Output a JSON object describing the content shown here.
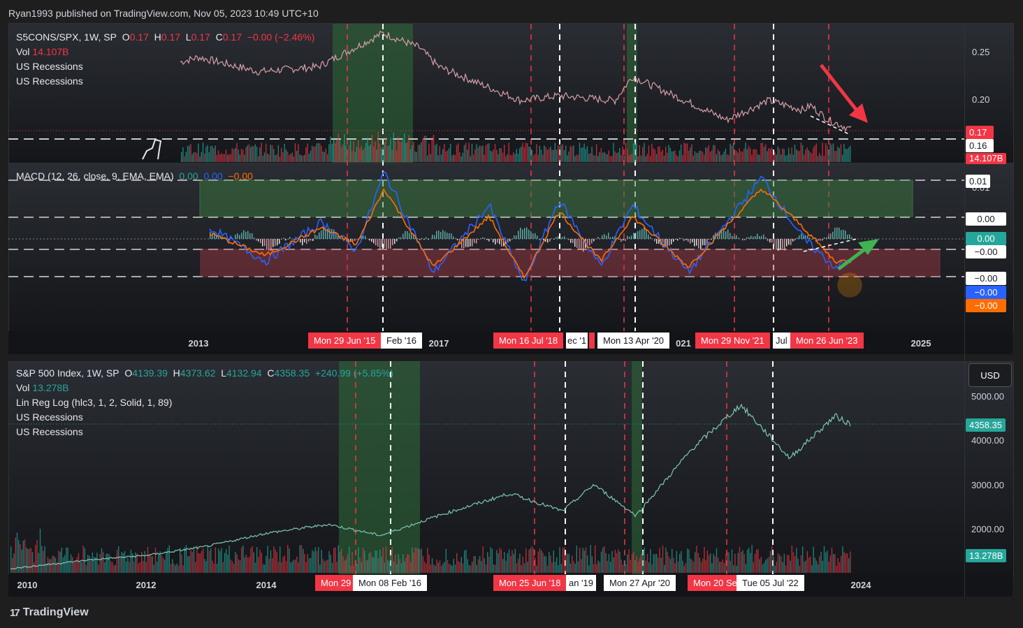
{
  "header": {
    "text": "Ryan1993 published on TradingView.com, Nov 05, 2023 10:49 UTC+10"
  },
  "pane1": {
    "legend": {
      "symbol": "S5CONS/SPX, 1W, SP",
      "o_label": "O",
      "o_value": "0.17",
      "h_label": "H",
      "h_value": "0.17",
      "l_label": "L",
      "l_value": "0.17",
      "c_label": "C",
      "c_value": "0.17",
      "change": "−0.00 (−2.46%)",
      "vol_label": "Vol",
      "vol_value": "14.107B",
      "rec1": "US Recessions",
      "rec2": "US Recessions"
    },
    "price_ticks": [
      "0.25",
      "0.20"
    ],
    "badges": {
      "last": "0.17",
      "line": "0.16",
      "vol": "14.107B"
    }
  },
  "pane2": {
    "legend": {
      "title": "MACD (12, 26, close, 9, EMA, EMA)",
      "v1": "0.00",
      "v2": "0.00",
      "v3": "−0.00"
    },
    "ticks": [
      "0.01",
      "0.00"
    ],
    "badges": [
      "0.01",
      "0.00",
      "0.00",
      "−0.00",
      "−0.00",
      "−0.00",
      "−0.00"
    ]
  },
  "axis1": {
    "ticks": [
      "2013",
      "2017",
      "2021",
      "2025"
    ],
    "date_labels": [
      "Mon 29 Jun '15",
      "Feb '16",
      "Mon 16 Jul '18",
      "ec '1",
      "Mon 13 Apr '20",
      "Mon 29 Nov '21",
      "Jul",
      "Mon 26 Jun '23"
    ],
    "partial_ticks": [
      "021"
    ]
  },
  "pane3": {
    "legend": {
      "symbol": "S&P 500 Index, 1W, SP",
      "o_label": "O",
      "o_value": "4139.39",
      "h_label": "H",
      "h_value": "4373.62",
      "l_label": "L",
      "l_value": "4132.94",
      "c_label": "C",
      "c_value": "4358.35",
      "change": "+240.99 (+5.85%)",
      "vol_label": "Vol",
      "vol_value": "13.278B",
      "linreg": "Lin Reg Log (hlc3, 1, 2, Solid, 1, 89)",
      "rec1": "US Recessions",
      "rec2": "US Recessions"
    },
    "currency": "USD",
    "price_ticks": [
      "5000.00",
      "4000.00",
      "3000.00",
      "2000.00"
    ],
    "badges": {
      "last": "4358.35",
      "vol": "13.278B"
    }
  },
  "axis3": {
    "ticks": [
      "2010",
      "2012",
      "2014",
      "2024"
    ],
    "date_labels": [
      "Mon 29",
      "Mon 08 Feb '16",
      "Mon 25 Jun '18",
      "an '19",
      "Mon 27 Apr '20",
      "Mon 20 Se",
      "Tue 05 Jul '22"
    ]
  },
  "brand": {
    "name": "TradingView",
    "mark": "17"
  },
  "colors": {
    "up": "#26a69a",
    "down": "#f23645",
    "macd": "#2962ff",
    "signal": "#ff6d00",
    "recession": "#2e6b38",
    "bg": "#1e1e1e"
  },
  "chart_data": [
    {
      "type": "line",
      "title": "S5CONS/SPX, 1W, SP",
      "x": [
        "2012-06",
        "2013",
        "2014",
        "2015",
        "2015-06",
        "2016",
        "2017",
        "2018",
        "2019",
        "2020",
        "2020-04",
        "2021",
        "2022",
        "2022-07",
        "2023",
        "2023-06",
        "2023-11"
      ],
      "values": [
        0.24,
        0.245,
        0.23,
        0.235,
        0.27,
        0.255,
        0.235,
        0.2,
        0.205,
        0.2,
        0.225,
        0.18,
        0.2,
        0.19,
        0.195,
        0.18,
        0.17
      ],
      "ylabel": "",
      "ylim": [
        0.16,
        0.28
      ],
      "last": 0.17,
      "horizontal_level": 0.16
    },
    {
      "type": "line",
      "title": "MACD (12, 26, close, 9, EMA, EMA)",
      "series": [
        {
          "name": "MACD",
          "values": [
            0.002,
            -0.004,
            0.003,
            -0.002,
            0.012,
            -0.006,
            0.006,
            -0.008,
            0.007,
            -0.005,
            0.006,
            -0.006,
            0.011,
            0.0,
            -0.005,
            -0.004
          ]
        },
        {
          "name": "Signal",
          "values": [
            0.001,
            -0.003,
            0.002,
            -0.001,
            0.009,
            -0.005,
            0.004,
            -0.007,
            0.005,
            -0.004,
            0.004,
            -0.005,
            0.009,
            0.002,
            -0.004,
            -0.004
          ]
        }
      ],
      "zones": [
        {
          "from": 0.0,
          "to": 0.01,
          "color": "green"
        },
        {
          "from": -0.0,
          "to": -0.0,
          "color": "red"
        }
      ]
    },
    {
      "type": "line",
      "title": "S&P 500 Index, 1W, SP",
      "x": [
        "2009-12",
        "2011",
        "2012",
        "2013",
        "2014",
        "2015",
        "2016-02",
        "2017",
        "2018",
        "2018-12",
        "2019",
        "2020-03",
        "2021",
        "2022-01",
        "2022-10",
        "2023-07",
        "2023-11"
      ],
      "values": [
        1100,
        1300,
        1400,
        1600,
        1900,
        2100,
        1850,
        2300,
        2800,
        2400,
        3000,
        2300,
        3800,
        4800,
        3600,
        4550,
        4358
      ],
      "ylim": [
        1700,
        5400
      ],
      "last": 4358.35
    }
  ]
}
